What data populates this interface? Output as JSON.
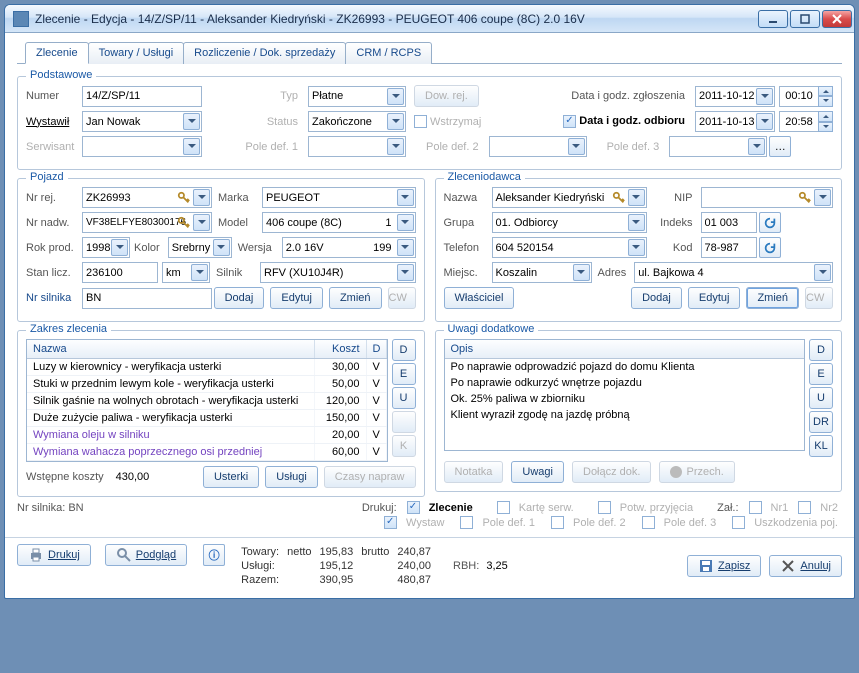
{
  "window": {
    "title": "Zlecenie - Edycja - 14/Z/SP/11 - Aleksander Kiedryński - ZK26993 - PEUGEOT 406 coupe (8C) 2.0 16V"
  },
  "tabs": [
    "Zlecenie",
    "Towary / Usługi",
    "Rozliczenie / Dok. sprzedaży",
    "CRM / RCPS"
  ],
  "basic": {
    "legend": "Podstawowe",
    "numer_l": "Numer",
    "numer_v": "14/Z/SP/11",
    "typ_l": "Typ",
    "typ_v": "Płatne",
    "dowrej_l": "Dow. rej.",
    "datazgl_l": "Data i godz. zgłoszenia",
    "datazgl_d": "2011-10-12",
    "datazgl_t": "00:10",
    "wystawil_l": "Wystawił",
    "wystawil_v": "Jan Nowak",
    "status_l": "Status",
    "status_v": "Zakończone",
    "wstrzymaj_l": "Wstrzymaj",
    "dataodb_l": "Data i godz. odbioru",
    "dataodb_d": "2011-10-13",
    "dataodb_t": "20:58",
    "serwisant_l": "Serwisant",
    "pd1_l": "Pole def. 1",
    "pd2_l": "Pole def. 2",
    "pd3_l": "Pole def. 3"
  },
  "veh": {
    "legend": "Pojazd",
    "nrrej_l": "Nr rej.",
    "nrrej_v": "ZK26993",
    "marka_l": "Marka",
    "marka_v": "PEUGEOT",
    "nrnad_l": "Nr nadw.",
    "nrnad_v": "VF38ELFYE80300176",
    "model_l": "Model",
    "model_v": "406 coupe (8C)",
    "model_n": "1",
    "rok_l": "Rok prod.",
    "rok_v": "1998",
    "kolor_l": "Kolor",
    "kolor_v": "Srebrny",
    "wersja_l": "Wersja",
    "wersja_v": "2.0 16V",
    "wersja_n": "199",
    "stan_l": "Stan licz.",
    "stan_v": "236100",
    "stan_u": "km",
    "silnik_l": "Silnik",
    "silnik_v": "RFV (XU10J4R)",
    "nrsil_l": "Nr silnika",
    "nrsil_v": "BN",
    "dodaj": "Dodaj",
    "edytuj": "Edytuj",
    "zmien": "Zmień",
    "cw": "CW"
  },
  "client": {
    "legend": "Zleceniodawca",
    "nazwa_l": "Nazwa",
    "nazwa_v": "Aleksander Kiedryński",
    "nip_l": "NIP",
    "nip_v": "",
    "grupa_l": "Grupa",
    "grupa_v": "01. Odbiorcy",
    "indeks_l": "Indeks",
    "indeks_v": "01 003",
    "tel_l": "Telefon",
    "tel_v": "604 520154",
    "kod_l": "Kod",
    "kod_v": "78-987",
    "miejsc_l": "Miejsc.",
    "miejsc_v": "Koszalin",
    "adres_l": "Adres",
    "adres_v": "ul. Bajkowa 4",
    "wlasciciel": "Właściciel",
    "dodaj": "Dodaj",
    "edytuj": "Edytuj",
    "zmien": "Zmień",
    "cw": "CW"
  },
  "scope": {
    "legend": "Zakres zlecenia",
    "col_n": "Nazwa",
    "col_k": "Koszt",
    "col_d": "D",
    "rows": [
      {
        "n": "Luzy w kierownicy - weryfikacja usterki",
        "k": "30,00",
        "d": "V",
        "p": false
      },
      {
        "n": "Stuki w przednim lewym kole - weryfikacja usterki",
        "k": "50,00",
        "d": "V",
        "p": false
      },
      {
        "n": "Silnik gaśnie na wolnych obrotach - weryfikacja usterki",
        "k": "120,00",
        "d": "V",
        "p": false
      },
      {
        "n": "Duże zużycie paliwa - weryfikacja usterki",
        "k": "150,00",
        "d": "V",
        "p": false
      },
      {
        "n": "Wymiana oleju w silniku",
        "k": "20,00",
        "d": "V",
        "p": true
      },
      {
        "n": "Wymiana wahacza poprzecznego osi przedniej",
        "k": "60,00",
        "d": "V",
        "p": true
      }
    ],
    "sb": [
      "D",
      "E",
      "U",
      "",
      "K"
    ],
    "wstepne_l": "Wstępne koszty",
    "wstepne_v": "430,00",
    "usterki": "Usterki",
    "uslugi": "Usługi",
    "czasy": "Czasy napraw"
  },
  "notes": {
    "legend": "Uwagi dodatkowe",
    "opis_h": "Opis",
    "lines": [
      "Po naprawie odprowadzić pojazd do domu Klienta",
      "Po naprawie odkurzyć wnętrze pojazdu",
      "Ok. 25% paliwa w zbiorniku",
      "Klient wyraził zgodę na jazdę próbną"
    ],
    "sb": [
      "D",
      "E",
      "U",
      "DR",
      "KL"
    ],
    "notatka": "Notatka",
    "uwagi": "Uwagi",
    "dolacz": "Dołącz dok.",
    "przech": "Przech."
  },
  "nrsil_footer": "Nr silnika: BN",
  "print": {
    "drukuj_l": "Drukuj:",
    "zlecenie": "Zlecenie",
    "karte": "Kartę serw.",
    "potw": "Potw. przyjęcia",
    "zal": "Zał.:",
    "nr1": "Nr1",
    "nr2": "Nr2",
    "wystaw": "Wystaw",
    "pd1": "Pole def. 1",
    "pd2": "Pole def. 2",
    "pd3": "Pole def. 3",
    "uszk": "Uszkodzenia poj."
  },
  "footer": {
    "drukuj": "Drukuj",
    "podglad": "Podgląd",
    "towary_l": "Towary:",
    "uslugi_l": "Usługi:",
    "razem_l": "Razem:",
    "netto_l": "netto",
    "brutto_l": "brutto",
    "tn": "195,83",
    "tb": "240,87",
    "un": "195,12",
    "ub": "240,00",
    "rn": "390,95",
    "rb": "480,87",
    "rbh_l": "RBH:",
    "rbh_v": "3,25",
    "zapisz": "Zapisz",
    "anuluj": "Anuluj"
  }
}
